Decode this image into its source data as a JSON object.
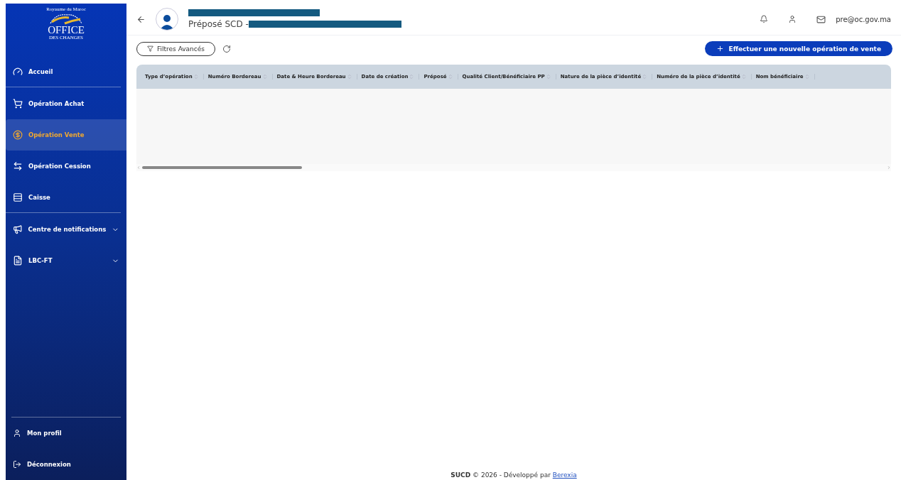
{
  "logo": {
    "kingdom": "Royaume du Maroc",
    "name": "OFFICE",
    "subname": "DES CHANGES"
  },
  "sidebar": {
    "items": [
      {
        "label": "Accueil",
        "selected": false,
        "expandable": false,
        "divider_after": true
      },
      {
        "label": "Opération Achat",
        "selected": false,
        "expandable": false,
        "divider_after": false
      },
      {
        "label": "Opération Vente",
        "selected": true,
        "expandable": false,
        "divider_after": false
      },
      {
        "label": "Opération Cession",
        "selected": false,
        "expandable": false,
        "divider_after": false
      },
      {
        "label": "Caisse",
        "selected": false,
        "expandable": false,
        "divider_after": true
      },
      {
        "label": "Centre de notifications",
        "selected": false,
        "expandable": true,
        "divider_after": false
      },
      {
        "label": "LBC-FT",
        "selected": false,
        "expandable": true,
        "divider_after": false
      }
    ],
    "bottom_items": [
      {
        "label": "Mon profil"
      },
      {
        "label": "Déconnexion"
      }
    ]
  },
  "header": {
    "role": "Préposé SCD -",
    "email": "pre@oc.gov.ma"
  },
  "toolbar": {
    "filter_button": "Filtres Avancés",
    "new_button": "Effectuer une nouvelle opération de vente"
  },
  "table": {
    "columns": [
      "Type d’opération",
      "Numéro Bordereau",
      "Date & Heure Bordereau",
      "Date de création",
      "Préposé",
      "Qualité Client/Bénéficiaire PP",
      "Nature de la pièce d’identité",
      "Numéro de la pièce d’identité",
      "Nom bénéficiaire"
    ]
  },
  "footer": {
    "text": "**SUCD** © 2026 - Développé par",
    "link": "Berexia"
  }
}
